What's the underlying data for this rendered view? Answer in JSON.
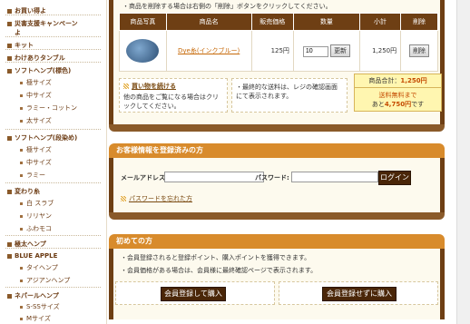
{
  "sidebar": {
    "items": [
      {
        "label": "お買い得よ",
        "type": "top"
      },
      {
        "label": "災害支援キャンペーン",
        "type": "top"
      },
      {
        "label": "よ",
        "type": "top-cont"
      },
      {
        "label": "キット",
        "type": "top"
      },
      {
        "label": "わけありタンブル",
        "type": "top"
      },
      {
        "label": "ソフトヘンプ(標色)",
        "type": "top"
      },
      {
        "label": "極サイズ",
        "type": "sub"
      },
      {
        "label": "中サイズ",
        "type": "sub"
      },
      {
        "label": "ラミー・コットン",
        "type": "sub"
      },
      {
        "label": "太サイズ",
        "type": "sub"
      },
      {
        "label": "ソフトヘンプ(段染め)",
        "type": "top"
      },
      {
        "label": "極サイズ",
        "type": "sub"
      },
      {
        "label": "中サイズ",
        "type": "sub"
      },
      {
        "label": "ラミー",
        "type": "sub"
      },
      {
        "label": "変わり糸",
        "type": "top"
      },
      {
        "label": "白 スラブ",
        "type": "sub"
      },
      {
        "label": "リリヤン",
        "type": "sub"
      },
      {
        "label": "ふわモコ",
        "type": "sub"
      },
      {
        "label": "極太ヘンプ",
        "type": "top"
      },
      {
        "label": "BLUE APPLE",
        "type": "top"
      },
      {
        "label": "タイヘンプ",
        "type": "sub"
      },
      {
        "label": "アジアンヘンプ",
        "type": "sub"
      },
      {
        "label": "ネパールヘンプ",
        "type": "top"
      },
      {
        "label": "S-SSサイズ",
        "type": "sub"
      },
      {
        "label": "Mサイズ",
        "type": "sub"
      }
    ]
  },
  "cart": {
    "delete_note": "商品を削除する場合は右側の「削除」ボタンをクリックしてください。",
    "headers": [
      "商品写真",
      "商品名",
      "販売価格",
      "数量",
      "小計",
      "削除"
    ],
    "rows": [
      {
        "name": "Dye糸(インクブルー)",
        "price": "125円",
        "qty": "10",
        "update": "更新",
        "subtotal": "1,250円",
        "delete": "削除"
      }
    ],
    "continue_link": "買い物を続ける",
    "continue_text": "他の商品をご覧になる場合はクリックしてください。",
    "shipping_note": "最終的な送料は、レジの確認画面にて表示されます。",
    "total_label": "商品合計：",
    "total_value": "1,250円",
    "free_shipping_1": "送料無料まで",
    "free_shipping_2_prefix": "あと",
    "free_shipping_amount": "4,750円",
    "free_shipping_2_suffix": "です"
  },
  "login": {
    "title": "お客様情報を登録済みの方",
    "email_label": "メールアドレス:",
    "email_value": "",
    "password_label": "パスワード:",
    "password_value": "",
    "login_button": "ログイン",
    "forgot_link": "パスワードを忘れた方"
  },
  "first_time": {
    "title": "初めての方",
    "note1": "会員登録されると登録ポイント、購入ポイントを獲得できます。",
    "note2": "会員価格がある場合は、会員様に最終確認ページで表示されます。",
    "register_button": "会員登録して購入",
    "guest_button": "会員登録せずに購入"
  }
}
